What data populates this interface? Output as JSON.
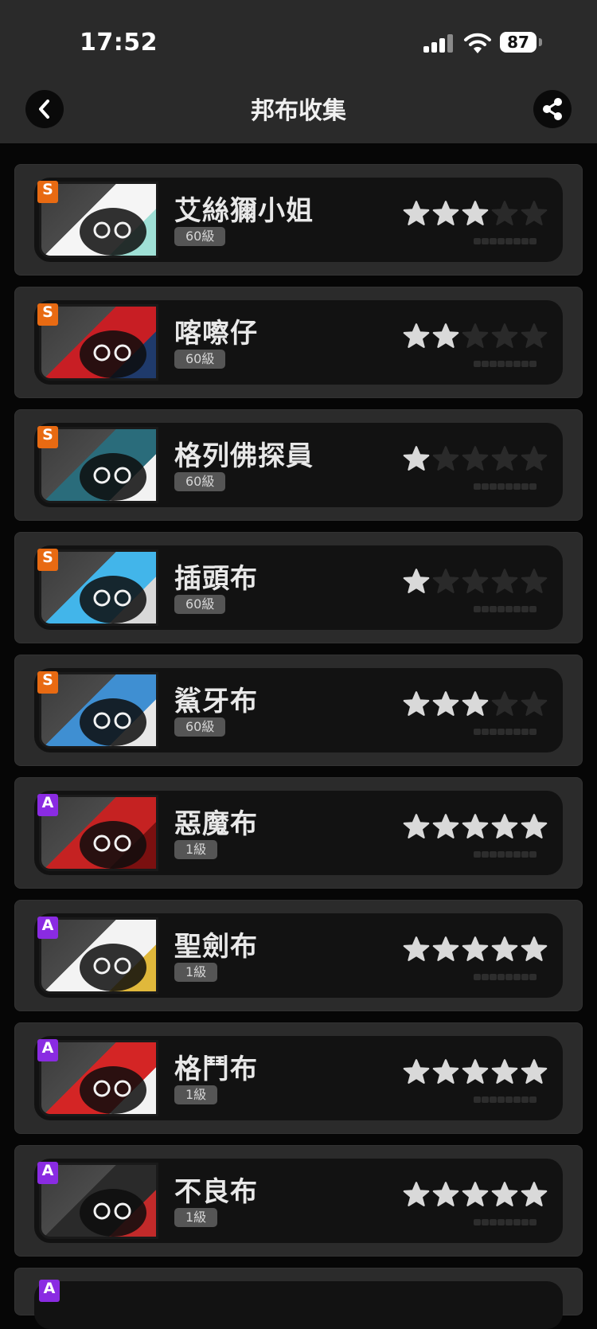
{
  "status": {
    "time": "17:52",
    "battery": "87"
  },
  "header": {
    "title": "邦布收集"
  },
  "items": [
    {
      "rank": "S",
      "name": "艾絲獮小姐",
      "level": "60級",
      "stars": 3,
      "colors": [
        "#f5f5f5",
        "#9fe0d6"
      ]
    },
    {
      "rank": "S",
      "name": "喀嚓仔",
      "level": "60級",
      "stars": 2,
      "colors": [
        "#c81e24",
        "#1f3a6b"
      ]
    },
    {
      "rank": "S",
      "name": "格列佛探員",
      "level": "60級",
      "stars": 1,
      "colors": [
        "#2a6c7b",
        "#f2f2f2"
      ]
    },
    {
      "rank": "S",
      "name": "插頭布",
      "level": "60級",
      "stars": 1,
      "colors": [
        "#42b5ea",
        "#d8d8d8"
      ]
    },
    {
      "rank": "S",
      "name": "鯊牙布",
      "level": "60級",
      "stars": 3,
      "colors": [
        "#3f8fd2",
        "#e8e8e8"
      ]
    },
    {
      "rank": "A",
      "name": "惡魔布",
      "level": "1級",
      "stars": 5,
      "colors": [
        "#c52222",
        "#7a1010"
      ]
    },
    {
      "rank": "A",
      "name": "聖劍布",
      "level": "1級",
      "stars": 5,
      "colors": [
        "#f3f3f3",
        "#e0b83b"
      ]
    },
    {
      "rank": "A",
      "name": "格鬥布",
      "level": "1級",
      "stars": 5,
      "colors": [
        "#d42525",
        "#f2f2f2"
      ]
    },
    {
      "rank": "A",
      "name": "不良布",
      "level": "1級",
      "stars": 5,
      "colors": [
        "#2a2a2a",
        "#c22a2a"
      ]
    }
  ],
  "rank_colors": {
    "S": "#e86a12",
    "A": "#8a2be2"
  },
  "partial_item": {
    "rank": "A"
  }
}
